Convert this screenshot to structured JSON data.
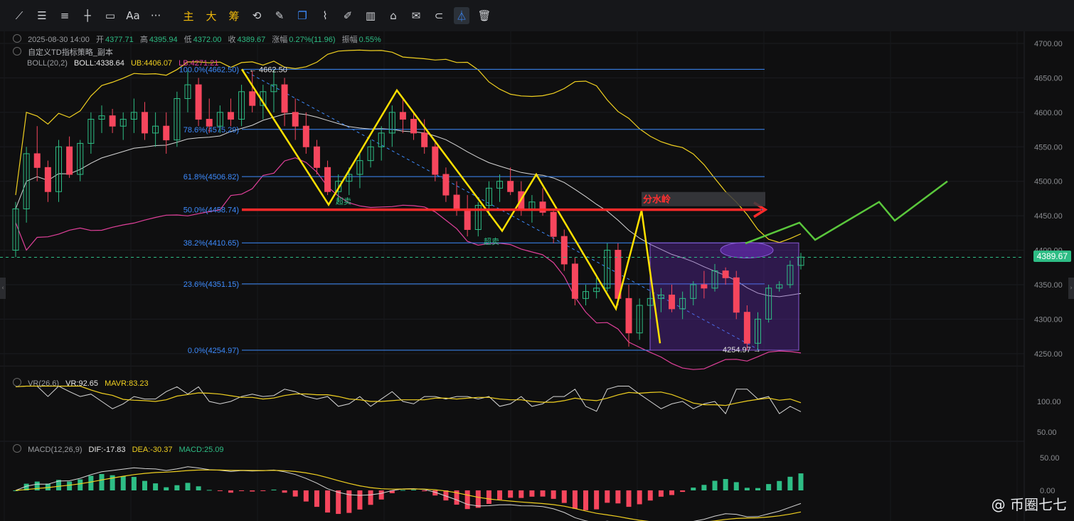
{
  "toolbar": {
    "tools": [
      {
        "name": "line-tool-icon",
        "glyph": "⟋"
      },
      {
        "name": "hline-multi-icon",
        "glyph": "☰"
      },
      {
        "name": "parallel-lines-icon",
        "glyph": "≡"
      },
      {
        "name": "cross-line-icon",
        "glyph": "┼"
      },
      {
        "name": "rectangle-tool-icon",
        "glyph": "▭"
      },
      {
        "name": "text-tool-icon",
        "glyph": "Aa"
      },
      {
        "name": "more-tools-icon",
        "glyph": "···"
      }
    ],
    "labels": [
      "主",
      "大",
      "筹"
    ],
    "tools2": [
      {
        "name": "sync-icon",
        "glyph": "⟲"
      },
      {
        "name": "pen-slash-icon",
        "glyph": "✎"
      },
      {
        "name": "copy-icon",
        "glyph": "❐"
      },
      {
        "name": "ruler-icon",
        "glyph": "⌇"
      },
      {
        "name": "brush-icon",
        "glyph": "✐"
      },
      {
        "name": "candles-icon",
        "glyph": "▥"
      },
      {
        "name": "lock-icon",
        "glyph": "⌂"
      },
      {
        "name": "note-icon",
        "glyph": "✉"
      },
      {
        "name": "magnet-icon",
        "glyph": "⊂"
      },
      {
        "name": "filter-icon",
        "glyph": "⏃"
      },
      {
        "name": "trash-icon",
        "glyph": "🗑"
      }
    ]
  },
  "legend": {
    "ohlc": {
      "date": "2025-08-30 14:00",
      "open_label": "开",
      "open": "4377.71",
      "high_label": "高",
      "high": "4395.94",
      "low_label": "低",
      "low": "4372.00",
      "close_label": "收",
      "close": "4389.67",
      "chg_label": "涨幅",
      "chg": "0.27%(11.96)",
      "amp_label": "振幅",
      "amp": "0.55%"
    },
    "strategy": "自定义TD指标策略_副本",
    "boll": {
      "name": "BOLL(20,2)",
      "mid": "BOLL:4338.64",
      "ub": "UB:4406.07",
      "lb": "LB:4271.21"
    },
    "vr": {
      "name": "VR(26,6)",
      "vr": "VR:92.65",
      "mavr": "MAVR:83.23"
    },
    "macd": {
      "name": "MACD(12,26,9)",
      "dif": "DIF:-17.83",
      "dea": "DEA:-30.37",
      "macd": "MACD:25.09"
    }
  },
  "price_tag": "4389.67",
  "watermark": "@ 币圈七七",
  "colors": {
    "up": "#2ebd85",
    "down": "#f6465d",
    "ub": "#f0d020",
    "mid": "#d6d6d6",
    "lb": "#e0409a",
    "fib": "#3d8bfd",
    "red_line": "#ff2a2a",
    "yellow_zig": "#ffe000",
    "green_proj": "#5ac73c",
    "box": "#6a2dbd"
  },
  "chart_data": {
    "type": "candlestick",
    "symbol_interval": "4h",
    "y_axis_ticks": [
      4250,
      4300,
      4350,
      4400,
      4450,
      4500,
      4550,
      4600,
      4650,
      4700
    ],
    "y_axis_labels": [
      "4250.00",
      "4300.00",
      "4350.00",
      "4400.00",
      "4450.00",
      "4500.00",
      "4550.00",
      "4600.00",
      "4650.00",
      "4700.00"
    ],
    "ylim": [
      4232,
      4712
    ],
    "candles": [
      [
        4400,
        4470,
        4390,
        4460
      ],
      [
        4460,
        4550,
        4440,
        4540
      ],
      [
        4540,
        4580,
        4500,
        4520
      ],
      [
        4520,
        4530,
        4470,
        4485
      ],
      [
        4485,
        4560,
        4470,
        4550
      ],
      [
        4550,
        4565,
        4505,
        4510
      ],
      [
        4510,
        4560,
        4500,
        4555
      ],
      [
        4555,
        4600,
        4540,
        4590
      ],
      [
        4590,
        4610,
        4570,
        4595
      ],
      [
        4595,
        4605,
        4570,
        4580
      ],
      [
        4580,
        4600,
        4560,
        4590
      ],
      [
        4590,
        4620,
        4570,
        4600
      ],
      [
        4600,
        4615,
        4560,
        4570
      ],
      [
        4570,
        4600,
        4550,
        4580
      ],
      [
        4580,
        4600,
        4540,
        4560
      ],
      [
        4560,
        4630,
        4550,
        4620
      ],
      [
        4620,
        4660,
        4600,
        4640
      ],
      [
        4640,
        4650,
        4580,
        4590
      ],
      [
        4590,
        4620,
        4570,
        4580
      ],
      [
        4580,
        4610,
        4570,
        4600
      ],
      [
        4600,
        4620,
        4580,
        4590
      ],
      [
        4590,
        4640,
        4580,
        4630
      ],
      [
        4630,
        4660,
        4600,
        4610
      ],
      [
        4610,
        4640,
        4590,
        4630
      ],
      [
        4630,
        4662,
        4600,
        4640
      ],
      [
        4640,
        4650,
        4580,
        4600
      ],
      [
        4600,
        4620,
        4560,
        4580
      ],
      [
        4580,
        4600,
        4540,
        4550
      ],
      [
        4550,
        4560,
        4510,
        4520
      ],
      [
        4520,
        4530,
        4480,
        4485
      ],
      [
        4485,
        4510,
        4470,
        4500
      ],
      [
        4500,
        4520,
        4480,
        4510
      ],
      [
        4510,
        4540,
        4490,
        4530
      ],
      [
        4530,
        4560,
        4520,
        4550
      ],
      [
        4550,
        4580,
        4530,
        4570
      ],
      [
        4570,
        4610,
        4550,
        4600
      ],
      [
        4600,
        4620,
        4570,
        4590
      ],
      [
        4590,
        4600,
        4560,
        4570
      ],
      [
        4570,
        4590,
        4540,
        4550
      ],
      [
        4550,
        4560,
        4500,
        4510
      ],
      [
        4510,
        4520,
        4470,
        4480
      ],
      [
        4480,
        4500,
        4450,
        4460
      ],
      [
        4460,
        4480,
        4420,
        4430
      ],
      [
        4430,
        4470,
        4420,
        4465
      ],
      [
        4465,
        4500,
        4450,
        4490
      ],
      [
        4490,
        4510,
        4470,
        4500
      ],
      [
        4500,
        4520,
        4480,
        4485
      ],
      [
        4485,
        4500,
        4450,
        4460
      ],
      [
        4460,
        4480,
        4440,
        4470
      ],
      [
        4470,
        4490,
        4450,
        4455
      ],
      [
        4455,
        4460,
        4410,
        4420
      ],
      [
        4420,
        4430,
        4370,
        4380
      ],
      [
        4380,
        4390,
        4320,
        4330
      ],
      [
        4330,
        4350,
        4320,
        4340
      ],
      [
        4340,
        4360,
        4330,
        4345
      ],
      [
        4345,
        4410,
        4340,
        4400
      ],
      [
        4400,
        4410,
        4320,
        4330
      ],
      [
        4330,
        4350,
        4260,
        4280
      ],
      [
        4280,
        4330,
        4270,
        4320
      ],
      [
        4320,
        4340,
        4300,
        4330
      ],
      [
        4330,
        4345,
        4310,
        4335
      ],
      [
        4335,
        4350,
        4310,
        4315
      ],
      [
        4315,
        4340,
        4300,
        4330
      ],
      [
        4330,
        4355,
        4320,
        4350
      ],
      [
        4350,
        4370,
        4330,
        4345
      ],
      [
        4345,
        4380,
        4340,
        4370
      ],
      [
        4370,
        4375,
        4350,
        4360
      ],
      [
        4360,
        4370,
        4300,
        4310
      ],
      [
        4310,
        4320,
        4255,
        4265
      ],
      [
        4265,
        4310,
        4255,
        4300
      ],
      [
        4300,
        4350,
        4295,
        4345
      ],
      [
        4345,
        4355,
        4340,
        4350
      ],
      [
        4350,
        4385,
        4345,
        4378
      ],
      [
        4378,
        4396,
        4372,
        4390
      ]
    ],
    "boll": {
      "ub_last": 4406.07,
      "mid_last": 4338.64,
      "lb_last": 4271.21
    },
    "fibonacci": [
      {
        "label": "100.0%(4662.50)",
        "value": 4662.5
      },
      {
        "label": "78.6%(4575.29)",
        "value": 4575.29
      },
      {
        "label": "61.8%(4506.82)",
        "value": 4506.82
      },
      {
        "label": "50.0%(4458.74)",
        "value": 4458.74
      },
      {
        "label": "38.2%(4410.65)",
        "value": 4410.65
      },
      {
        "label": "23.6%(4351.15)",
        "value": 4351.15
      },
      {
        "label": "0.0%(4254.97)",
        "value": 4254.97
      }
    ],
    "annotations": {
      "high_label": "4662.50",
      "low_label": "4254.97",
      "oversold_1": "超卖",
      "oversold_2": "超卖",
      "watershed": "分水岭"
    },
    "vr_ticks": [
      {
        "v": 100,
        "label": "100.00"
      },
      {
        "v": 50,
        "label": "50.00"
      }
    ],
    "macd_ticks": [
      {
        "v": 50,
        "label": "50.00"
      },
      {
        "v": 0,
        "label": "0.00"
      }
    ]
  }
}
